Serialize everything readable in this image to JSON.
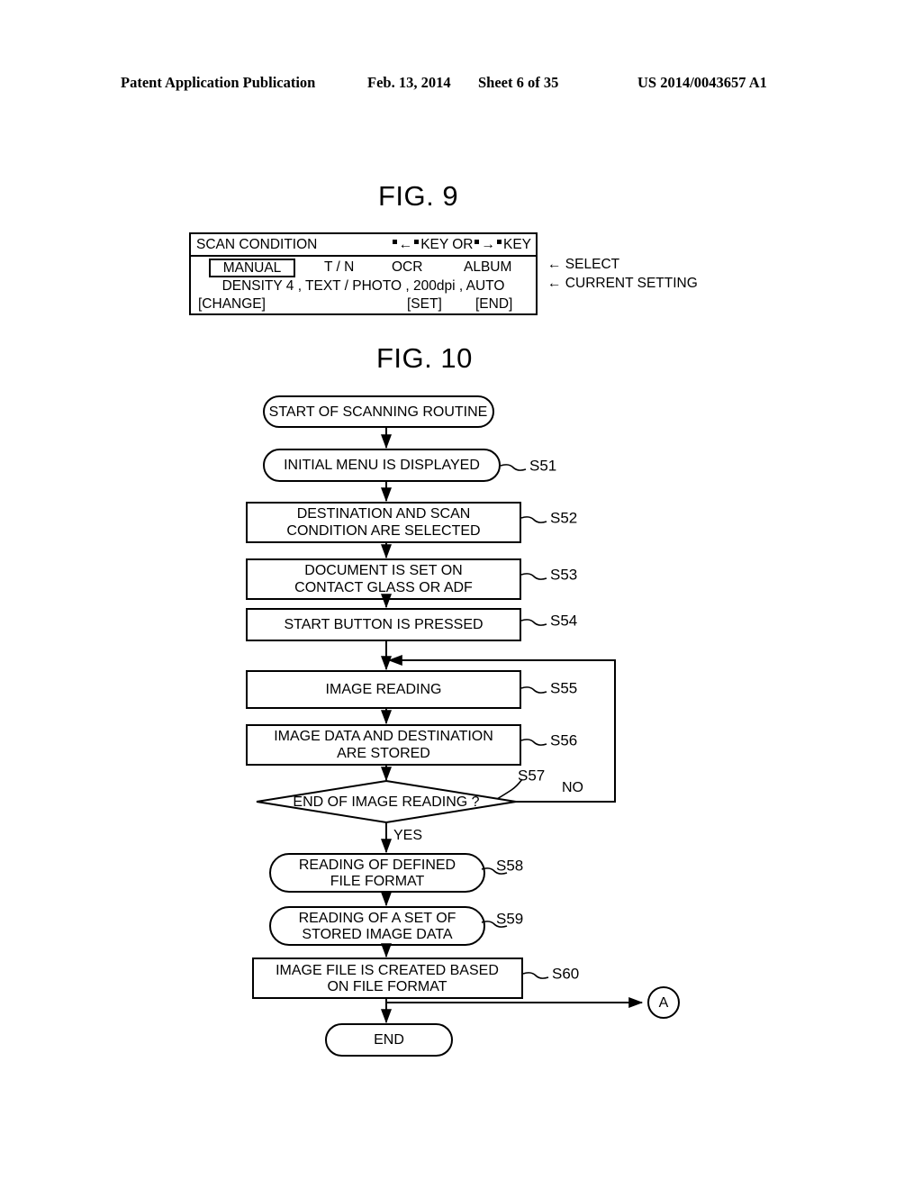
{
  "header": {
    "publication": "Patent Application Publication",
    "date": "Feb. 13, 2014",
    "sheet": "Sheet 6 of 35",
    "number": "US 2014/0043657 A1"
  },
  "fig9": {
    "title": "FIG. 9",
    "panel": {
      "screen_label": "SCAN CONDITION",
      "key_hint_prefix": "",
      "key_hint_left_arrow": "←",
      "key_hint_mid": "KEY OR",
      "key_hint_right_arrow": "→",
      "key_hint_suffix": "KEY",
      "selected_mode": "MANUAL",
      "modes": [
        "T / N",
        "OCR",
        "ALBUM"
      ],
      "current_setting": "DENSITY 4 , TEXT / PHOTO , 200dpi , AUTO",
      "softkeys": {
        "change": "[CHANGE]",
        "set": "[SET]",
        "end": "[END]"
      }
    },
    "callouts": {
      "select": "← SELECT",
      "current": "← CURRENT SETTING"
    }
  },
  "fig10": {
    "title": "FIG. 10",
    "nodes": {
      "start": "START OF SCANNING ROUTINE",
      "s51": "INITIAL MENU IS DISPLAYED",
      "s52_line1": "DESTINATION AND SCAN",
      "s52_line2": "CONDITION ARE SELECTED",
      "s53_line1": "DOCUMENT IS SET ON",
      "s53_line2": "CONTACT GLASS OR ADF",
      "s54": "START BUTTON IS PRESSED",
      "s55": "IMAGE READING",
      "s56_line1": "IMAGE DATA AND DESTINATION",
      "s56_line2": "ARE STORED",
      "s57": "END OF IMAGE READING ?",
      "s58_line1": "READING OF DEFINED",
      "s58_line2": "FILE FORMAT",
      "s59_line1": "READING OF A SET OF",
      "s59_line2": "STORED IMAGE DATA",
      "s60_line1": "IMAGE FILE IS CREATED BASED",
      "s60_line2": "ON FILE FORMAT",
      "end": "END",
      "connector_a": "A"
    },
    "step_labels": {
      "s51": "S51",
      "s52": "S52",
      "s53": "S53",
      "s54": "S54",
      "s55": "S55",
      "s56": "S56",
      "s57": "S57",
      "s58": "S58",
      "s59": "S59",
      "s60": "S60"
    },
    "branches": {
      "yes": "YES",
      "no": "NO"
    }
  }
}
